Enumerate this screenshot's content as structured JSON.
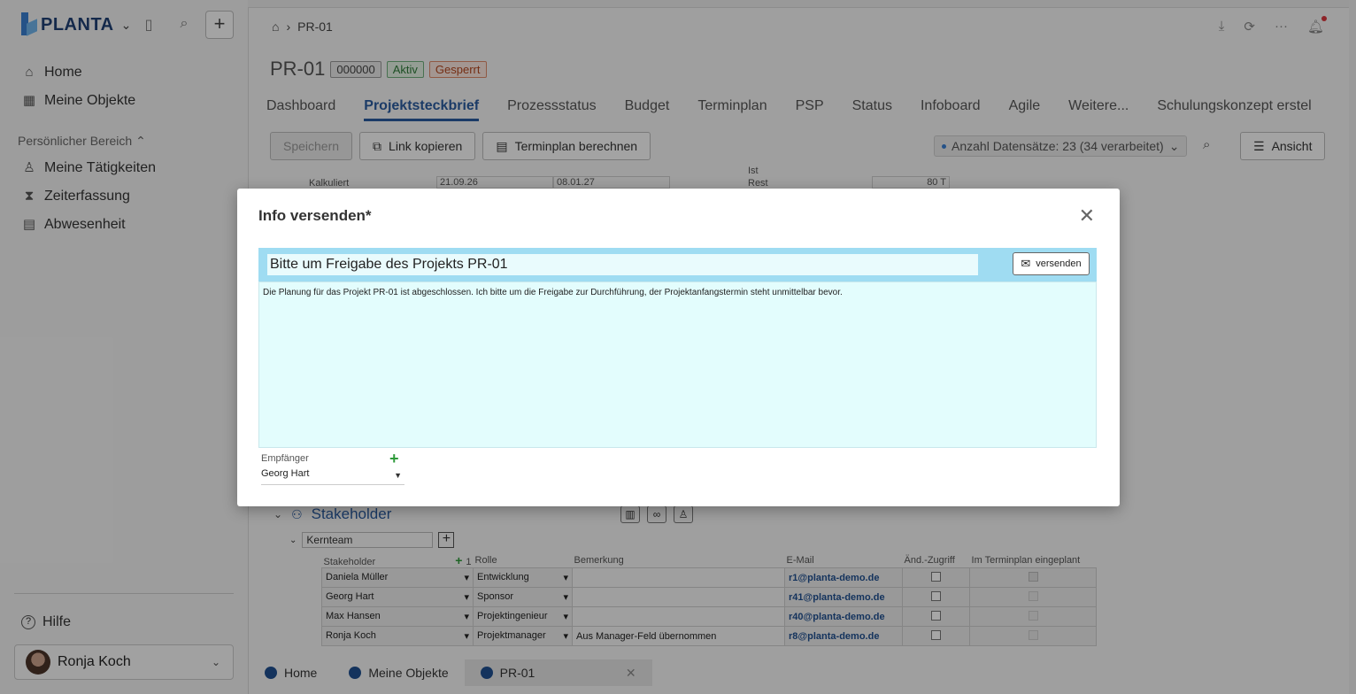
{
  "sidebar": {
    "logo": "PLANTA",
    "items": [
      {
        "label": "Home",
        "icon": "home-icon"
      },
      {
        "label": "Meine Objekte",
        "icon": "grid-icon"
      }
    ],
    "section_label": "Persönlicher Bereich",
    "personal_items": [
      {
        "label": "Meine Tätigkeiten",
        "icon": "user-icon"
      },
      {
        "label": "Zeiterfassung",
        "icon": "hourglass-icon"
      },
      {
        "label": "Abwesenheit",
        "icon": "calendar-icon"
      }
    ],
    "help": "Hilfe",
    "user": "Ronja Koch"
  },
  "main": {
    "breadcrumb": "PR-01",
    "title": "PR-01",
    "badges": {
      "number": "000000",
      "active": "Aktiv",
      "locked": "Gesperrt"
    },
    "tabs": [
      "Dashboard",
      "Projektsteckbrief",
      "Prozessstatus",
      "Budget",
      "Terminplan",
      "PSP",
      "Status",
      "Infoboard",
      "Agile",
      "Weitere...",
      "Schulungskonzept erstel",
      "···"
    ],
    "active_tab": "Projektsteckbrief",
    "toolbar": {
      "save": "Speichern",
      "copy_link": "Link kopieren",
      "calc_schedule": "Terminplan berechnen",
      "records": "Anzahl Datensätze: 23 (34 verarbeitet)",
      "view": "Ansicht"
    },
    "bg_row": {
      "label": "Kalkuliert",
      "date1": "21.09.26",
      "date2": "08.01.27",
      "ist": "Ist",
      "rest": "Rest",
      "value": "80 T"
    },
    "stakeholder": {
      "title": "Stakeholder",
      "group": "Kernteam",
      "sort_indicator": "1",
      "columns": [
        "Stakeholder",
        "Rolle",
        "Bemerkung",
        "E-Mail",
        "Änd.-Zugriff",
        "Im Terminplan eingeplant"
      ],
      "rows": [
        {
          "name": "Daniela Müller",
          "role": "Entwicklung",
          "note": "",
          "email": "r1@planta-demo.de"
        },
        {
          "name": "Georg Hart",
          "role": "Sponsor",
          "note": "",
          "email": "r41@planta-demo.de"
        },
        {
          "name": "Max Hansen",
          "role": "Projektingenieur",
          "note": "",
          "email": "r40@planta-demo.de"
        },
        {
          "name": "Ronja Koch",
          "role": "Projektmanager",
          "note": "Aus Manager-Feld übernommen",
          "email": "r8@planta-demo.de"
        }
      ]
    },
    "bottom_tabs": [
      "Home",
      "Meine Objekte",
      "PR-01"
    ]
  },
  "modal": {
    "title": "Info versenden*",
    "subject": "Bitte um Freigabe des Projekts PR-01",
    "send_label": "versenden",
    "body": "Die Planung für das Projekt PR-01 ist abgeschlossen. Ich bitte um die Freigabe zur Durchführung, der Projektanfangstermin steht unmittelbar bevor.",
    "recipient_label": "Empfänger",
    "recipient_value": "Georg Hart"
  }
}
